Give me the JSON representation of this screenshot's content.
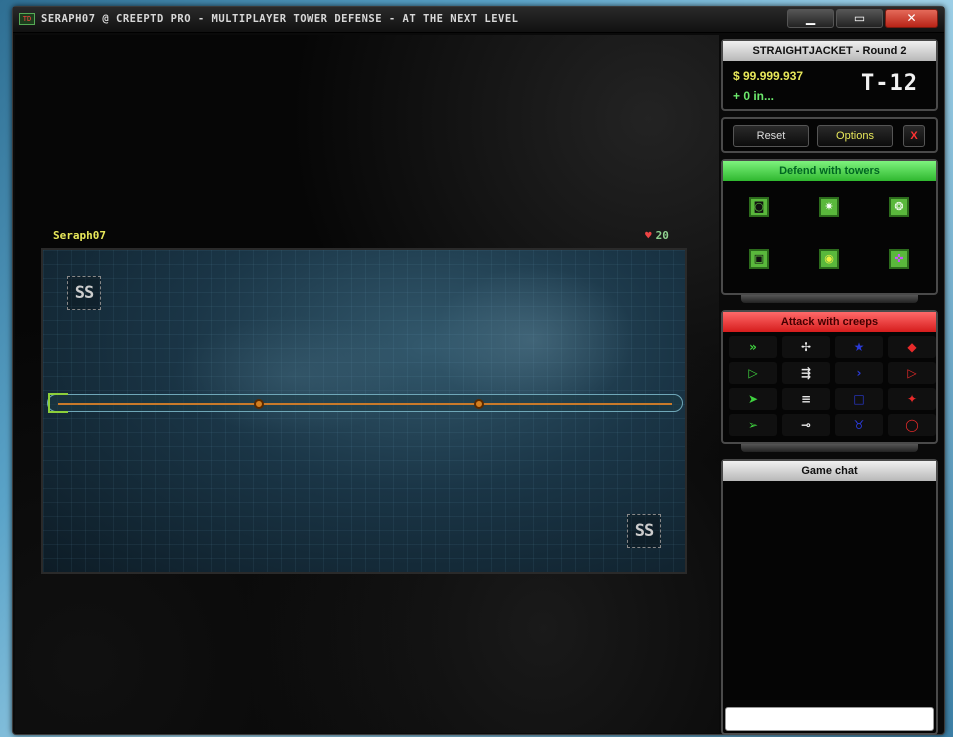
{
  "window": {
    "title": "SERAPH07 @ CREEPTD PRO - MULTIPLAYER TOWER DEFENSE - AT THE NEXT LEVEL",
    "icon_text": "TD",
    "minimize_symbol": "▁",
    "maximize_symbol": "▭",
    "close_symbol": "✕"
  },
  "game": {
    "player": "Seraph07",
    "lives": "20",
    "spawn_label_a": "SS",
    "spawn_label_b": "SS"
  },
  "status": {
    "header": "STRAIGHTJACKET - Round 2",
    "money": "$ 99.999.937",
    "income": "+ 0 in...",
    "timer": "T-12"
  },
  "controls": {
    "reset": "Reset",
    "options": "Options",
    "close": "X"
  },
  "towers": {
    "header": "Defend with towers",
    "items": [
      {
        "icon": "gun-tower-icon",
        "glyph": "◙"
      },
      {
        "icon": "starburst-tower-icon",
        "glyph": "✷"
      },
      {
        "icon": "orb-tower-icon",
        "glyph": "❂"
      },
      {
        "icon": "square-tower-icon",
        "glyph": "▣"
      },
      {
        "icon": "dot-tower-icon",
        "glyph": "◉"
      },
      {
        "icon": "crosshair-tower-icon",
        "glyph": "✜"
      }
    ]
  },
  "creeps": {
    "header": "Attack with creeps",
    "items": [
      {
        "icon": "double-chevron-icon",
        "glyph": "»",
        "color": "#3fd23f"
      },
      {
        "icon": "cross-arrows-icon",
        "glyph": "✢",
        "color": "#e8e8e8"
      },
      {
        "icon": "star-icon",
        "glyph": "★",
        "color": "#2a3ad8"
      },
      {
        "icon": "diamond-icon",
        "glyph": "◆",
        "color": "#e82a2a"
      },
      {
        "icon": "arrow-outline-icon",
        "glyph": "▷",
        "color": "#3fd23f"
      },
      {
        "icon": "arrow-ship-icon",
        "glyph": "⇶",
        "color": "#e8e8e8"
      },
      {
        "icon": "chevron-icon",
        "glyph": "›",
        "color": "#2a3ad8"
      },
      {
        "icon": "triangle-icon",
        "glyph": "▷",
        "color": "#e82a2a"
      },
      {
        "icon": "arrowhead-icon",
        "glyph": "➤",
        "color": "#3fd23f"
      },
      {
        "icon": "bars-icon",
        "glyph": "≡",
        "color": "#e8e8e8"
      },
      {
        "icon": "square-outline-icon",
        "glyph": "□",
        "color": "#2a3ad8"
      },
      {
        "icon": "spark-icon",
        "glyph": "✦",
        "color": "#e82a2a"
      },
      {
        "icon": "dart-icon",
        "glyph": "➢",
        "color": "#3fd23f"
      },
      {
        "icon": "key-icon",
        "glyph": "⊸",
        "color": "#e8e8e8"
      },
      {
        "icon": "bug-icon",
        "glyph": "♉",
        "color": "#2a3ad8"
      },
      {
        "icon": "ring-icon",
        "glyph": "◯",
        "color": "#e82a2a"
      }
    ]
  },
  "chat": {
    "header": "Game chat",
    "input_value": ""
  }
}
